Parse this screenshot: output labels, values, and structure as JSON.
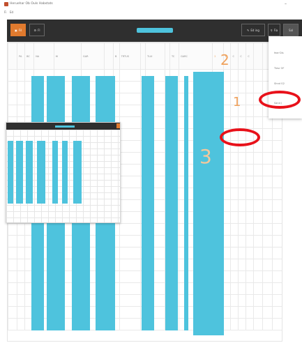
{
  "window": {
    "title": "Heruehar Ob Ouls Habstats",
    "minimize_glyph": "–"
  },
  "menu": [
    "Fi",
    "Ed"
  ],
  "toolbar": {
    "primary_button": "Fil",
    "secondary_button": "Fl",
    "right_buttons": [
      "Ed ing",
      "Fia",
      "Sal"
    ]
  },
  "grid": {
    "headers": [
      "",
      "PA",
      "BC",
      "NA",
      "HI",
      "GAR",
      "",
      "B",
      "TRTUS",
      "",
      "TLUI",
      "",
      "TC",
      "GARC",
      "2",
      "T",
      "C",
      "C",
      "C",
      "",
      "",
      ""
    ],
    "row_count": 22
  },
  "dropdown": {
    "items": [
      "fear·Dis",
      "Tlesr OF",
      "Shnd G2",
      "Sand J"
    ]
  },
  "annotations": {
    "one": "1",
    "two": "2",
    "three": "3"
  },
  "colors": {
    "accent_orange": "#e07a2e",
    "highlight_blue": "#4ec3dd",
    "annotation_red": "#e8111a"
  }
}
